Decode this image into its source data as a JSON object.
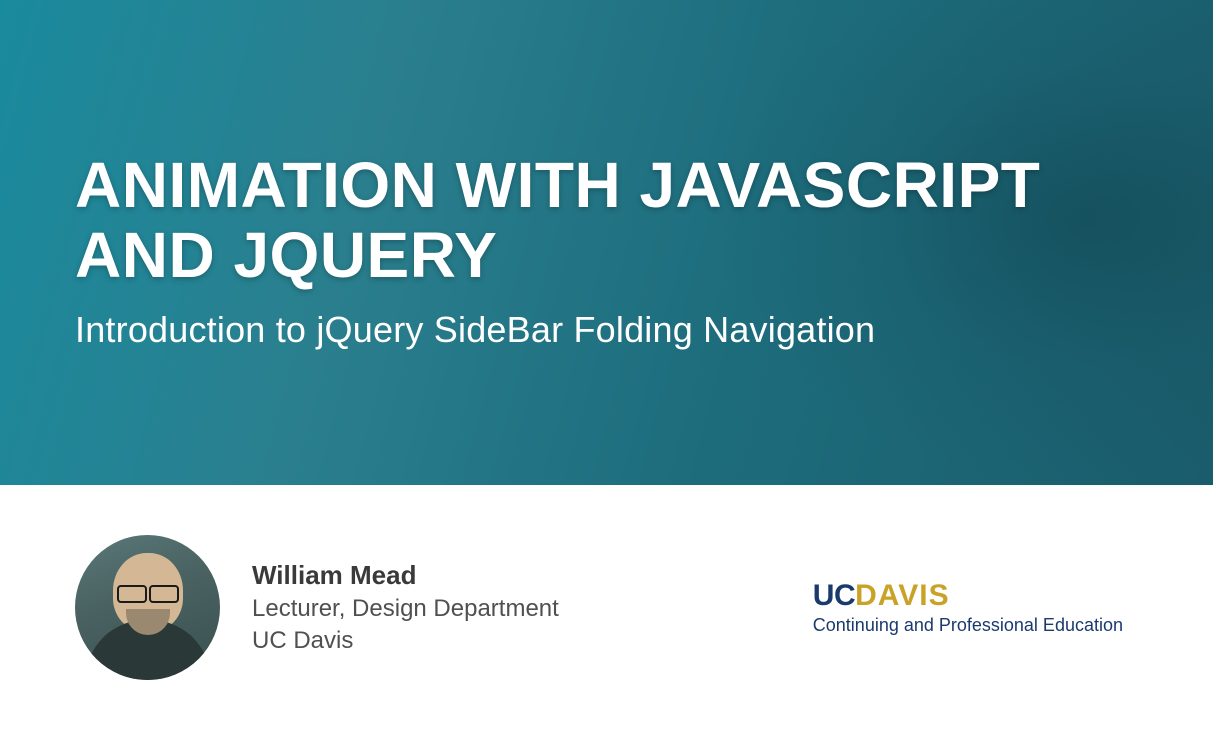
{
  "hero": {
    "title": "ANIMATION WITH JAVASCRIPT AND JQUERY",
    "subtitle": "Introduction to jQuery SideBar Folding Navigation"
  },
  "presenter": {
    "name": "William Mead",
    "title": "Lecturer, Design Department",
    "organization": "UC Davis"
  },
  "institution": {
    "logo_prefix": "UC",
    "logo_main": "DAVIS",
    "tagline": "Continuing and Professional Education"
  }
}
